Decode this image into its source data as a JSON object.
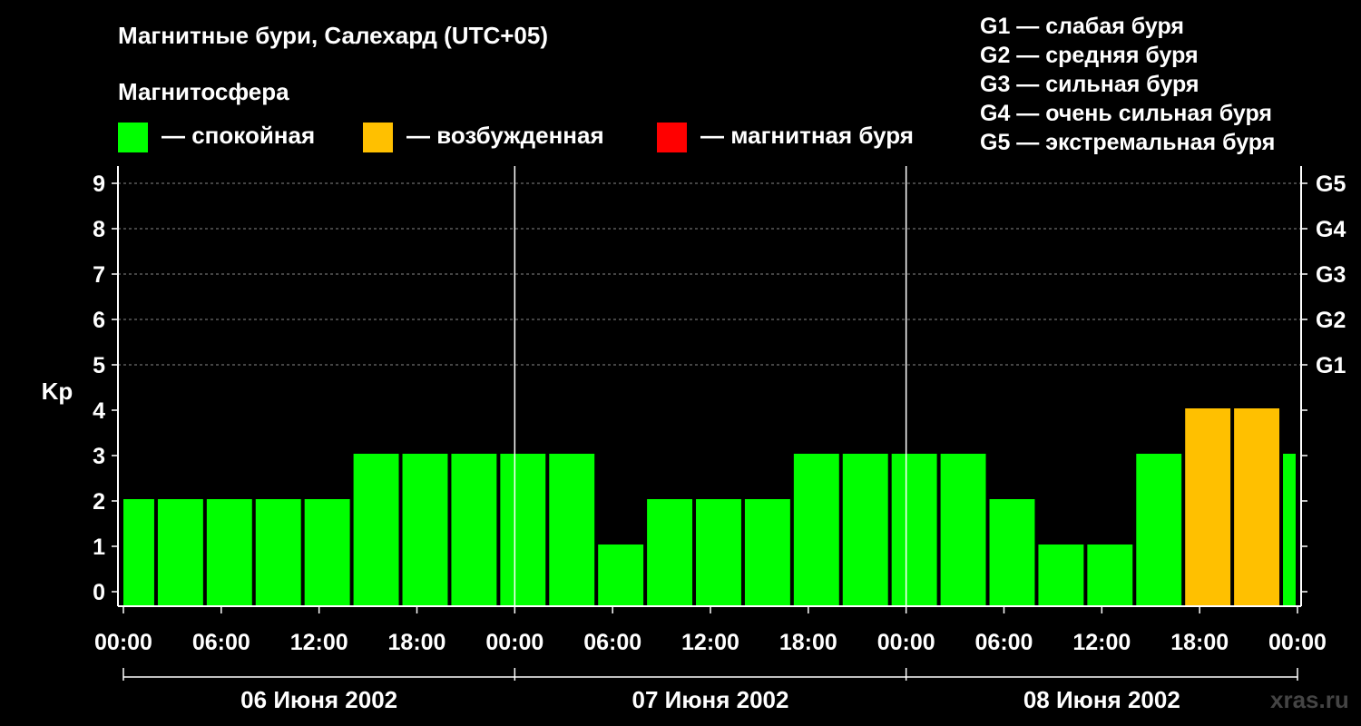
{
  "title": "Магнитные бури, Салехард (UTC+05)",
  "legend": {
    "title": "Магнитосфера",
    "items": [
      {
        "label": "— спокойная",
        "color": "#00ff00"
      },
      {
        "label": "— возбужденная",
        "color": "#ffc000"
      },
      {
        "label": "— магнитная буря",
        "color": "#ff0000"
      }
    ]
  },
  "g_legend": [
    "G1 — слабая буря",
    "G2 — средняя буря",
    "G3 — сильная буря",
    "G4 — очень сильная буря",
    "G5 — экстремальная буря"
  ],
  "watermark": "xras.ru",
  "chart_data": {
    "type": "bar",
    "ylabel": "Kp",
    "ylim": [
      0,
      9
    ],
    "yticks": [
      0,
      1,
      2,
      3,
      4,
      5,
      6,
      7,
      8,
      9
    ],
    "right_ticks": [
      {
        "value": 5,
        "label": "G1"
      },
      {
        "value": 6,
        "label": "G2"
      },
      {
        "value": 7,
        "label": "G3"
      },
      {
        "value": 8,
        "label": "G4"
      },
      {
        "value": 9,
        "label": "G5"
      }
    ],
    "x_hours_range": [
      0,
      72
    ],
    "xtick_labels": [
      "00:00",
      "06:00",
      "12:00",
      "18:00",
      "00:00",
      "06:00",
      "12:00",
      "18:00",
      "00:00",
      "06:00",
      "12:00",
      "18:00",
      "00:00"
    ],
    "days": [
      "06 Июня 2002",
      "07 Июня 2002",
      "08 Июня 2002"
    ],
    "grid": true,
    "bars": [
      {
        "start": "00:00",
        "end": "02:00",
        "value": 2,
        "status": "спокойная"
      },
      {
        "start": "02:00",
        "end": "05:00",
        "value": 2,
        "status": "спокойная"
      },
      {
        "start": "05:00",
        "end": "08:00",
        "value": 2,
        "status": "спокойная"
      },
      {
        "start": "08:00",
        "end": "11:00",
        "value": 2,
        "status": "спокойная"
      },
      {
        "start": "11:00",
        "end": "14:00",
        "value": 2,
        "status": "спокойная"
      },
      {
        "start": "14:00",
        "end": "17:00",
        "value": 3,
        "status": "спокойная"
      },
      {
        "start": "17:00",
        "end": "20:00",
        "value": 3,
        "status": "спокойная"
      },
      {
        "start": "20:00",
        "end": "23:00",
        "value": 3,
        "status": "спокойная"
      },
      {
        "start": "23:00",
        "end": "02:00",
        "value": 3,
        "status": "спокойная"
      },
      {
        "start": "02:00",
        "end": "05:00",
        "value": 3,
        "status": "спокойная"
      },
      {
        "start": "05:00",
        "end": "08:00",
        "value": 1,
        "status": "спокойная"
      },
      {
        "start": "08:00",
        "end": "11:00",
        "value": 2,
        "status": "спокойная"
      },
      {
        "start": "11:00",
        "end": "14:00",
        "value": 2,
        "status": "спокойная"
      },
      {
        "start": "14:00",
        "end": "17:00",
        "value": 2,
        "status": "спокойная"
      },
      {
        "start": "17:00",
        "end": "20:00",
        "value": 3,
        "status": "спокойная"
      },
      {
        "start": "20:00",
        "end": "23:00",
        "value": 3,
        "status": "спокойная"
      },
      {
        "start": "23:00",
        "end": "02:00",
        "value": 3,
        "status": "спокойная"
      },
      {
        "start": "02:00",
        "end": "05:00",
        "value": 3,
        "status": "спокойная"
      },
      {
        "start": "05:00",
        "end": "08:00",
        "value": 2,
        "status": "спокойная"
      },
      {
        "start": "08:00",
        "end": "11:00",
        "value": 1,
        "status": "спокойная"
      },
      {
        "start": "11:00",
        "end": "14:00",
        "value": 1,
        "status": "спокойная"
      },
      {
        "start": "14:00",
        "end": "17:00",
        "value": 3,
        "status": "спокойная"
      },
      {
        "start": "17:00",
        "end": "20:00",
        "value": 4,
        "status": "возбужденная"
      },
      {
        "start": "20:00",
        "end": "23:00",
        "value": 4,
        "status": "возбужденная"
      },
      {
        "start": "23:00",
        "end": "24:00",
        "value": 3,
        "status": "спокойная"
      }
    ]
  }
}
